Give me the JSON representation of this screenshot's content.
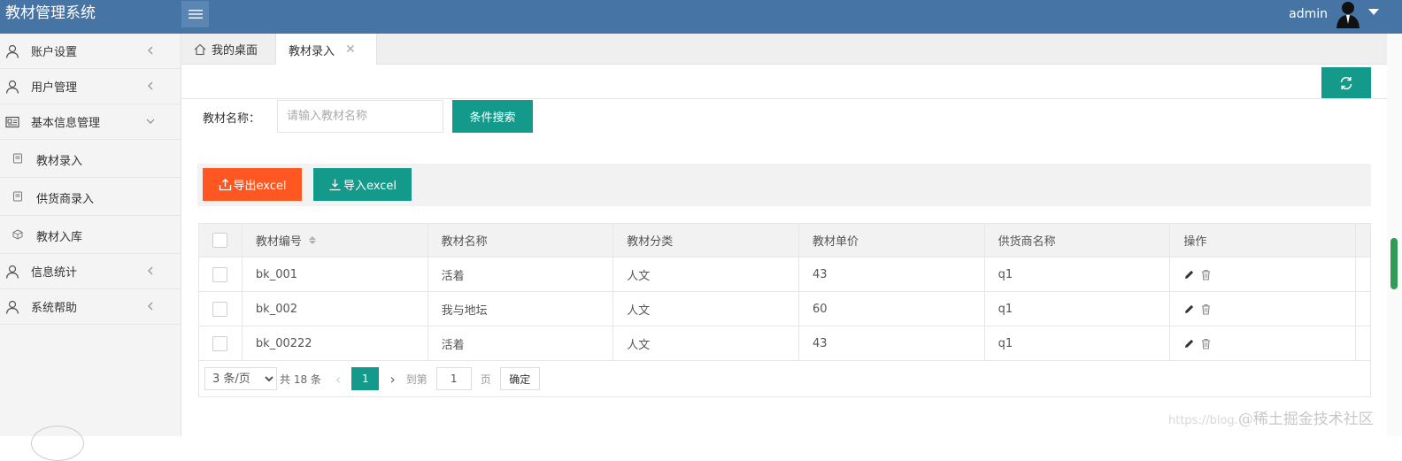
{
  "header": {
    "app_title": "教材管理系统",
    "username": "admin"
  },
  "sidebar": {
    "items": [
      {
        "label": "账户设置"
      },
      {
        "label": "用户管理"
      },
      {
        "label": "基本信息管理"
      },
      {
        "label": "信息统计"
      },
      {
        "label": "系统帮助"
      }
    ],
    "subitems": [
      {
        "label": "教材录入"
      },
      {
        "label": "供货商录入"
      },
      {
        "label": "教材入库"
      }
    ]
  },
  "tabs": {
    "home": "我的桌面",
    "active": "教材录入",
    "close": "✕"
  },
  "search": {
    "label": "教材名称：",
    "placeholder": "请输入教材名称",
    "button": "条件搜索"
  },
  "toolbar": {
    "export": "导出excel",
    "import": "导入excel"
  },
  "table": {
    "headers": [
      "教材编号",
      "教材名称",
      "教材分类",
      "教材单价",
      "供货商名称",
      "操作"
    ],
    "rows": [
      [
        "bk_001",
        "活着",
        "人文",
        "43",
        "q1"
      ],
      [
        "bk_002",
        "我与地坛",
        "人文",
        "60",
        "q1"
      ],
      [
        "bk_00222",
        "活着",
        "人文",
        "43",
        "q1"
      ]
    ]
  },
  "pager": {
    "page_size": "3 条/页",
    "total": "共 18 条",
    "current": "1",
    "goto": "到第",
    "goto_value": "1",
    "page_unit": "页",
    "confirm": "确定"
  },
  "watermark": {
    "small": "https://blog.",
    "text": "@稀土掘金技术社区"
  },
  "colors": {
    "header": "#4574a5",
    "primary": "#149a8a",
    "danger": "#ff5722"
  }
}
